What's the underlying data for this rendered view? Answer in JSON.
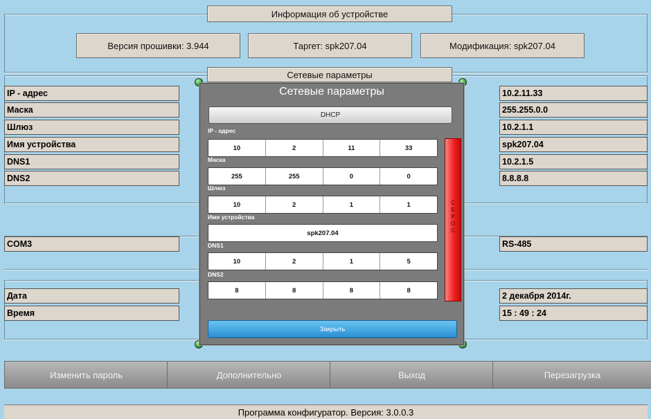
{
  "device_info": {
    "title": "Информация об устройстве",
    "firmware": "Версия прошивки: 3.944",
    "target": "Таргет: spk207.04",
    "modification": "Модификация: spk207.04"
  },
  "network": {
    "title": "Сетевые параметры",
    "rows": [
      {
        "label": "IP - адрес",
        "value": "10.2.11.33"
      },
      {
        "label": "Маска",
        "value": "255.255.0.0"
      },
      {
        "label": "Шлюз",
        "value": "10.2.1.1"
      },
      {
        "label": "Имя устройства",
        "value": "spk207.04"
      },
      {
        "label": "DNS1",
        "value": "10.2.1.5"
      },
      {
        "label": "DNS2",
        "value": "8.8.8.8"
      }
    ]
  },
  "com": {
    "label": "COM3",
    "value": "RS-485"
  },
  "datetime": {
    "date_label": "Дата",
    "date_value": "2 декабря 2014г.",
    "time_label": "Время",
    "time_value": "15 : 49 : 24"
  },
  "modal": {
    "title": "Сетевые параметры",
    "dhcp": "DHCP",
    "ip_label": "IP - адрес",
    "ip": [
      "10",
      "2",
      "11",
      "33"
    ],
    "mask_label": "Маска",
    "mask": [
      "255",
      "255",
      "0",
      "0"
    ],
    "gateway_label": "Шлюз",
    "gateway": [
      "10",
      "2",
      "1",
      "1"
    ],
    "name_label": "Имя устройства",
    "name": "spk207.04",
    "dns1_label": "DNS1",
    "dns1": [
      "10",
      "2",
      "1",
      "5"
    ],
    "dns2_label": "DNS2",
    "dns2": [
      "8",
      "8",
      "8",
      "8"
    ],
    "reset": [
      "С",
      "Б",
      "Р",
      "О",
      "С"
    ],
    "close": "Закрыть"
  },
  "buttons": {
    "change_password": "Изменить пароль",
    "advanced": "Дополнительно",
    "exit": "Выход",
    "reboot": "Перезагрузка"
  },
  "footer": "Программа конфигуратор. Версия: 3.0.0.3"
}
